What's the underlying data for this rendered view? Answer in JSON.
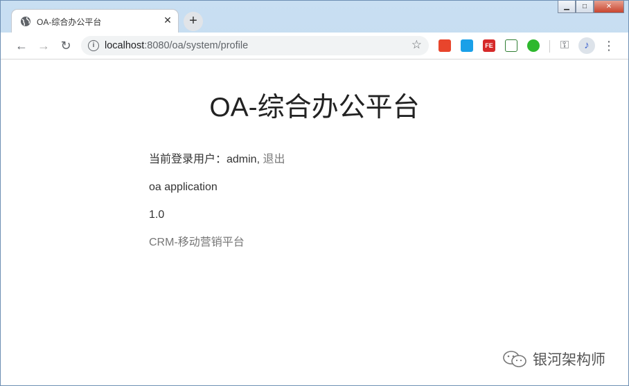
{
  "browser": {
    "tab_title": "OA-综合办公平台",
    "tab_close": "✕",
    "new_tab": "+",
    "url_host": "localhost",
    "url_rest": ":8080/oa/system/profile",
    "info_icon": "i",
    "star_icon": "☆",
    "back": "←",
    "forward": "→",
    "reload": "↻",
    "window_controls": {
      "minimize": "▁",
      "maximize": "□",
      "close": "✕"
    },
    "extensions": [
      {
        "name": "dice-extension-icon",
        "label": "",
        "color": "#e8452c"
      },
      {
        "name": "mixer-extension-icon",
        "label": "",
        "color": "#1aa0e8"
      },
      {
        "name": "fe-extension-icon",
        "label": "FE",
        "color": "#d62a2a"
      },
      {
        "name": "graph-extension-icon",
        "label": "",
        "color": "#2e7d32"
      },
      {
        "name": "check-extension-icon",
        "label": "",
        "color": "#2eb82e"
      }
    ],
    "key_icon": "⚿",
    "profile_icon": "♪",
    "menu_icon": "⋮"
  },
  "page": {
    "title": "OA-综合办公平台",
    "user_prefix": "当前登录用户：admin,",
    "logout": "退出",
    "app_name": "oa application",
    "version": "1.0",
    "link_text": "CRM-移动营销平台"
  },
  "watermark": {
    "text": "银河架构师"
  }
}
